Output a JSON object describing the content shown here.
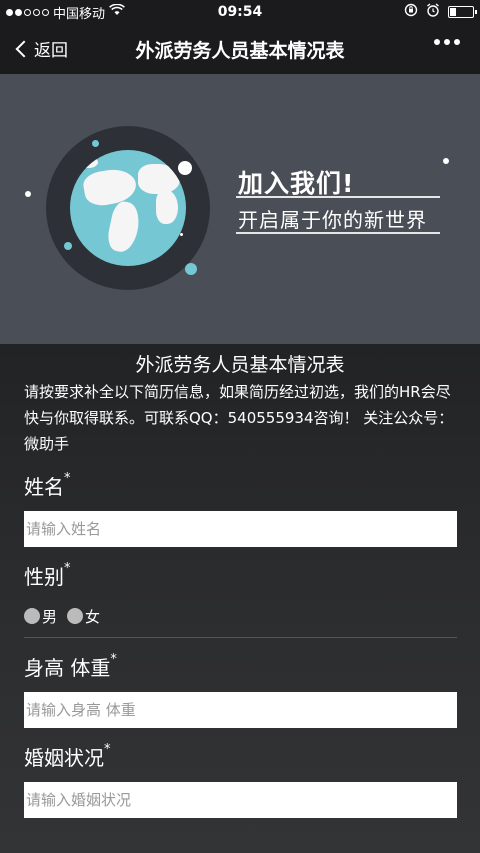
{
  "status": {
    "carrier": "中国移动",
    "time": "09:54"
  },
  "nav": {
    "back_label": "返回",
    "title": "外派劳务人员基本情况表"
  },
  "banner": {
    "headline": "加入我们!",
    "subline": "开启属于你的新世界"
  },
  "form": {
    "title": "外派劳务人员基本情况表",
    "description": "请按要求补全以下简历信息，如果简历经过初选，我们的HR会尽快与你取得联系。可联系QQ：540555934咨询！ 关注公众号：微助手",
    "required_mark": "*",
    "fields": {
      "name": {
        "label": "姓名",
        "placeholder": "请输入姓名"
      },
      "gender": {
        "label": "性别",
        "options": [
          "男",
          "女"
        ]
      },
      "height_weight": {
        "label": "身高 体重",
        "placeholder": "请输入身高 体重"
      },
      "marital": {
        "label": "婚姻状况",
        "placeholder": "请输入婚姻状况"
      }
    }
  },
  "colors": {
    "nav_bg": "#1b1b1d",
    "banner_bg": "#4a4e56",
    "globe_ocean": "#75c7d3"
  }
}
